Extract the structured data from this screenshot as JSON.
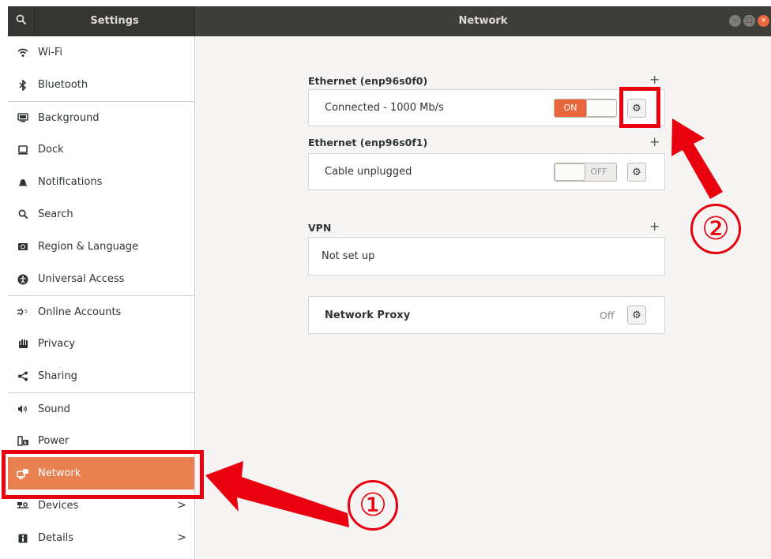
{
  "header": {
    "app_title": "Settings",
    "page_title": "Network",
    "search_icon": "search-icon",
    "window_controls": [
      "minimize",
      "maximize",
      "close"
    ]
  },
  "sidebar": {
    "items": [
      {
        "label": "Wi-Fi",
        "icon": "wifi-icon"
      },
      {
        "label": "Bluetooth",
        "icon": "bluetooth-icon"
      },
      {
        "label": "Background",
        "icon": "background-icon"
      },
      {
        "label": "Dock",
        "icon": "dock-icon"
      },
      {
        "label": "Notifications",
        "icon": "bell-icon"
      },
      {
        "label": "Search",
        "icon": "search-icon"
      },
      {
        "label": "Region & Language",
        "icon": "region-icon"
      },
      {
        "label": "Universal Access",
        "icon": "accessibility-icon"
      },
      {
        "label": "Online Accounts",
        "icon": "online-accounts-icon"
      },
      {
        "label": "Privacy",
        "icon": "hand-icon"
      },
      {
        "label": "Sharing",
        "icon": "share-icon"
      },
      {
        "label": "Sound",
        "icon": "speaker-icon"
      },
      {
        "label": "Power",
        "icon": "power-icon"
      },
      {
        "label": "Network",
        "icon": "network-icon",
        "active": true
      },
      {
        "label": "Devices",
        "icon": "devices-icon",
        "chevron": ">"
      },
      {
        "label": "Details",
        "icon": "info-icon",
        "chevron": ">"
      }
    ]
  },
  "network": {
    "ethernet1": {
      "title": "Ethernet (enp96s0f0)",
      "add": "+",
      "status": "Connected - 1000 Mb/s",
      "switch_label": "ON",
      "switch_on": true
    },
    "ethernet2": {
      "title": "Ethernet (enp96s0f1)",
      "add": "+",
      "status": "Cable unplugged",
      "switch_label": "OFF",
      "switch_on": false
    },
    "vpn": {
      "title": "VPN",
      "add": "+",
      "status": "Not set up"
    },
    "proxy": {
      "title": "Network Proxy",
      "status": "Off"
    }
  },
  "annotations": {
    "marker1": "①",
    "marker2": "②",
    "color": "#e8000e"
  },
  "colors": {
    "accent": "#e9804f",
    "switch_on": "#e9663c",
    "headerbar": "#3d3d3a"
  }
}
